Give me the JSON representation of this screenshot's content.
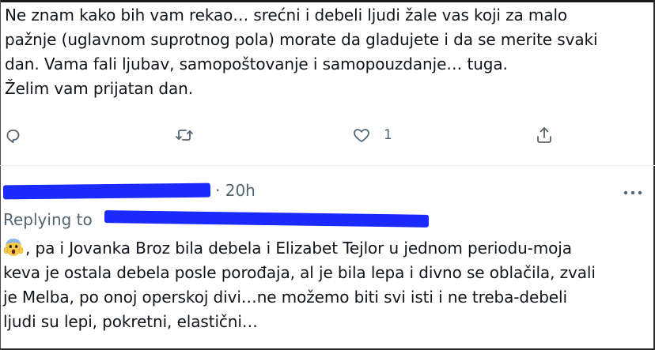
{
  "tweet": {
    "text_lines": [
      "Ne znam kako bih vam rekao… srećni i debeli ljudi žale vas koji za malo",
      "pažnje (uglavnom suprotnog pola) morate da gladujete i da se merite svaki",
      "dan. Vama fali ljubav, samopoštovanje i samopouzdanje… tuga.",
      "Želim vam prijatan dan."
    ],
    "actions": {
      "reply_icon": "comment-bubble",
      "retweet_icon": "retweet-arrows",
      "like_icon": "heart-outline",
      "like_count": "1",
      "share_icon": "share-upload"
    }
  },
  "reply": {
    "time": "· 20h",
    "replying_label": "Replying to",
    "more_icon": "ellipsis-horizontal",
    "emoji": "face-screaming-in-fear",
    "text_lines": [
      ", pa i Jovanka Broz bila debela i Elizabet Tejlor u jednom periodu-moja",
      "keva je ostala debela posle porođaja, al je bila lepa i divno se oblačila, zvali",
      "je Melba, po onoj operskoj divi…ne možemo biti svi isti i ne treba-debeli",
      "ljudi su lepi, pokretni, elastični…"
    ]
  },
  "colors": {
    "text": "#0f1419",
    "muted": "#536471",
    "redaction": "#1b2bff",
    "divider": "#eff3f4"
  }
}
